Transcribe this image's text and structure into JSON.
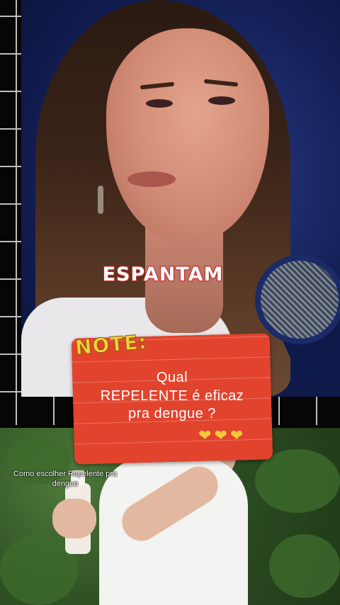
{
  "overlay": {
    "highlight_word": "ESPANTAM",
    "note_tag": "NOTE:",
    "note_lines": [
      "Qual",
      "REPELENTE é eficaz",
      "pra dengue ?"
    ],
    "hearts": "❤❤❤"
  },
  "bottom": {
    "caption": "Como escolher Repelente pra dengue"
  },
  "colors": {
    "card": "#e2432d",
    "tag": "#f4d235",
    "word_stroke": "#c52a2a"
  }
}
